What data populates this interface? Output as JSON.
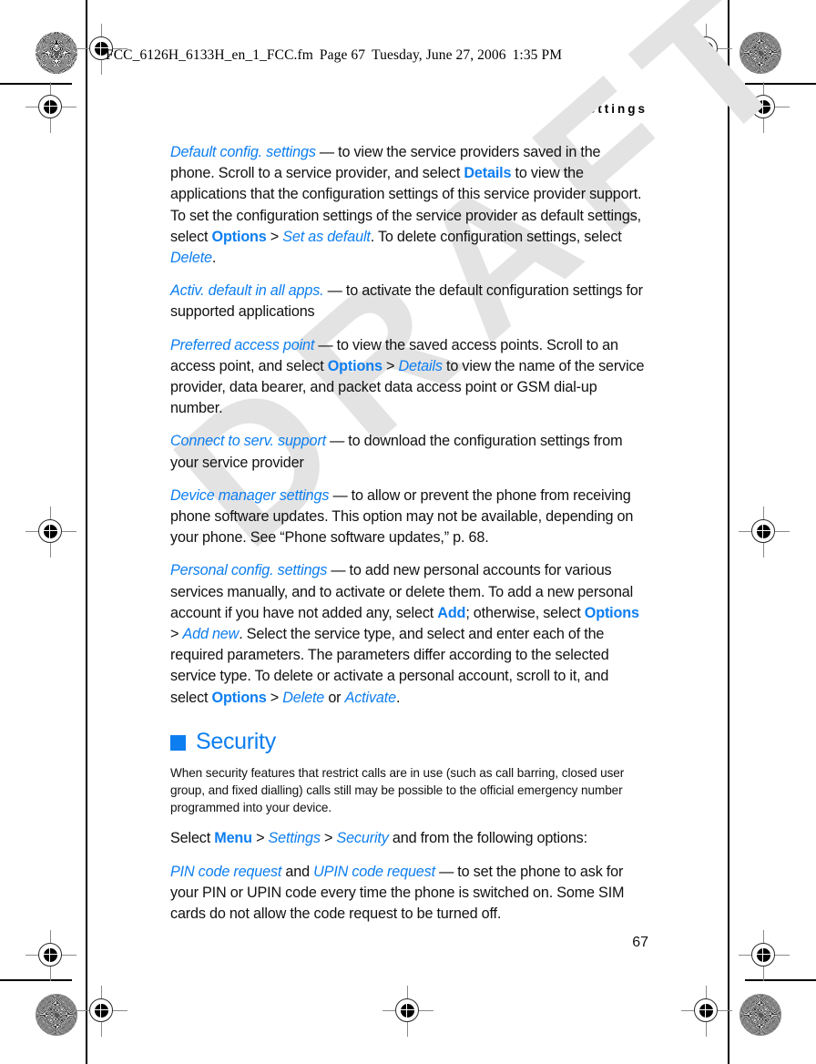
{
  "filmstrip": {
    "filename": "FCC_6126H_6133H_en_1_FCC.fm",
    "page_label": "Page 67",
    "date": "Tuesday, June 27, 2006",
    "time": "1:35 PM"
  },
  "running_head": "Settings",
  "watermark": "DRAFT",
  "folio": "67",
  "accent_color": "#0d7ef0",
  "paragraphs": [
    {
      "id": "default-config-settings",
      "runs": [
        {
          "type": "term",
          "text": "Default config. settings"
        },
        {
          "type": "plain",
          "text": " — to view the service providers saved in the phone. Scroll to a service provider, and select "
        },
        {
          "type": "ui",
          "text": "Details"
        },
        {
          "type": "plain",
          "text": " to view the applications that the configuration settings of this service provider support. To set the configuration settings of the service provider as default settings, select "
        },
        {
          "type": "ui",
          "text": "Options"
        },
        {
          "type": "plain",
          "text": " > "
        },
        {
          "type": "ital",
          "text": "Set as default"
        },
        {
          "type": "plain",
          "text": ". To delete configuration settings, select "
        },
        {
          "type": "ital",
          "text": "Delete"
        },
        {
          "type": "plain",
          "text": "."
        }
      ]
    },
    {
      "id": "activ-default-in-all-apps",
      "runs": [
        {
          "type": "term",
          "text": "Activ. default in all apps."
        },
        {
          "type": "plain",
          "text": " — to activate the default configuration settings for supported applications"
        }
      ]
    },
    {
      "id": "preferred-access-point",
      "runs": [
        {
          "type": "term",
          "text": "Preferred access point"
        },
        {
          "type": "plain",
          "text": " — to view the saved access points. Scroll to an access point, and select "
        },
        {
          "type": "ui",
          "text": "Options"
        },
        {
          "type": "plain",
          "text": " > "
        },
        {
          "type": "ital",
          "text": "Details"
        },
        {
          "type": "plain",
          "text": " to view the name of the service provider, data bearer, and packet data access point or GSM dial-up number."
        }
      ]
    },
    {
      "id": "connect-to-serv-support",
      "runs": [
        {
          "type": "term",
          "text": "Connect to serv. support"
        },
        {
          "type": "plain",
          "text": " — to download the configuration settings from your service provider"
        }
      ]
    },
    {
      "id": "device-manager-settings",
      "runs": [
        {
          "type": "term",
          "text": "Device manager settings"
        },
        {
          "type": "plain",
          "text": " — to allow or prevent the phone from receiving phone software updates. This option may not be available, depending on your phone. See “Phone software updates,” p. 68."
        }
      ]
    },
    {
      "id": "personal-config-settings",
      "runs": [
        {
          "type": "term",
          "text": "Personal config. settings"
        },
        {
          "type": "plain",
          "text": " — to add new personal accounts for various services manually, and to activate or delete them. To add a new personal account if you have not added any, select "
        },
        {
          "type": "ui",
          "text": "Add"
        },
        {
          "type": "plain",
          "text": "; otherwise, select "
        },
        {
          "type": "ui",
          "text": "Options"
        },
        {
          "type": "plain",
          "text": " > "
        },
        {
          "type": "ital",
          "text": "Add new"
        },
        {
          "type": "plain",
          "text": ". Select the service type, and select and enter each of the required parameters. The parameters differ according to the selected service type. To delete or activate a personal account, scroll to it, and select "
        },
        {
          "type": "ui",
          "text": "Options"
        },
        {
          "type": "plain",
          "text": " > "
        },
        {
          "type": "ital",
          "text": "Delete"
        },
        {
          "type": "plain",
          "text": " or "
        },
        {
          "type": "ital",
          "text": "Activate"
        },
        {
          "type": "plain",
          "text": "."
        }
      ]
    }
  ],
  "section": {
    "heading": "Security",
    "bullet_color": "#0d7ef0",
    "paragraphs": [
      {
        "id": "security-warning",
        "style": "note",
        "runs": [
          {
            "type": "plain",
            "text": "When security features that restrict calls are in use (such as call barring, closed user group, and fixed dialling) calls still may be possible to the official emergency number programmed into your device."
          }
        ]
      },
      {
        "id": "security-path",
        "style": "body",
        "runs": [
          {
            "type": "plain",
            "text": "Select "
          },
          {
            "type": "ui",
            "text": "Menu"
          },
          {
            "type": "plain",
            "text": " > "
          },
          {
            "type": "ital",
            "text": "Settings"
          },
          {
            "type": "plain",
            "text": " > "
          },
          {
            "type": "ital",
            "text": "Security"
          },
          {
            "type": "plain",
            "text": " and from the following options:"
          }
        ]
      },
      {
        "id": "pin-code-request",
        "style": "body",
        "runs": [
          {
            "type": "term",
            "text": "PIN code request"
          },
          {
            "type": "plain",
            "text": " and "
          },
          {
            "type": "term",
            "text": "UPIN code request"
          },
          {
            "type": "plain",
            "text": " — to set the phone to ask for your PIN or UPIN code every time the phone is switched on. Some SIM cards do not allow the code request to be turned off."
          }
        ]
      }
    ]
  }
}
